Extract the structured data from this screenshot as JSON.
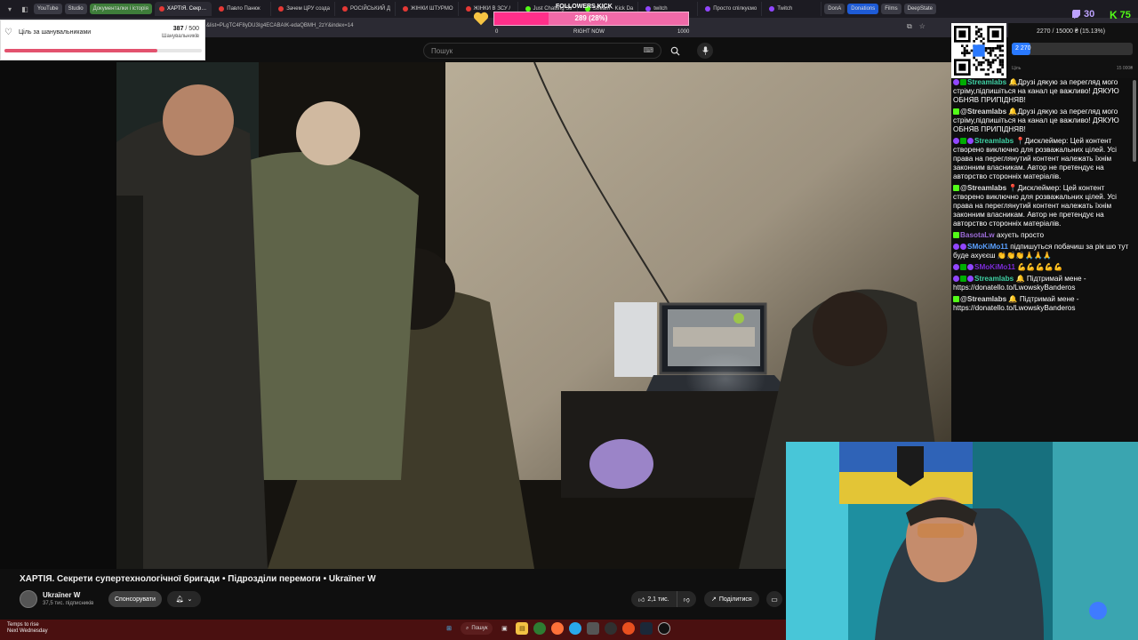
{
  "browser": {
    "bookmarks": [
      {
        "label": "YouTube",
        "green": false
      },
      {
        "label": "Studio",
        "green": false
      },
      {
        "label": "Документалки і історія",
        "green": true
      }
    ],
    "tabs": [
      {
        "label": "ХАРТІЯ. Секр…",
        "active": true,
        "color": "red"
      },
      {
        "label": "Павло Панюк ",
        "active": false,
        "color": "red"
      },
      {
        "label": "Зачем ЦРУ созда",
        "active": false,
        "color": "red"
      },
      {
        "label": "РОСІЙСЬКИЙ Д",
        "active": false,
        "color": "red"
      },
      {
        "label": "ЖІНКИ ШТУРМО",
        "active": false,
        "color": "red"
      },
      {
        "label": "ЖІНКИ В ЗСУ /",
        "active": false,
        "color": "red"
      },
      {
        "label": "Just Chatting Str",
        "active": false,
        "color": "green"
      },
      {
        "label": "Stream - Kick Da",
        "active": false,
        "color": "green"
      },
      {
        "label": "twitch",
        "active": false,
        "color": "purple"
      },
      {
        "label": "Просто спілкуємо",
        "active": false,
        "color": "purple"
      },
      {
        "label": "Twitch",
        "active": false,
        "color": "purple"
      }
    ],
    "extra_bookmarks": [
      "DonA",
      "Donations",
      "Films",
      "DeepState"
    ],
    "url": "&list=PLgTC4F8yDU3Ig4ECABAIK-edaQBMH_2zY&index=14"
  },
  "youtube": {
    "search_placeholder": "Пошук",
    "video_title": "ХАРТІЯ. Секрети супертехнологічної бригади • Підрозділи перемоги • Ukraїner W",
    "channel_name": "Ukraїner W",
    "channel_subs": "37,5 тис. підписників",
    "sponsor_label": "Спонсорувати",
    "like_count": "2,1 тис.",
    "share_label": "Поділитися"
  },
  "goal_widget": {
    "title": "Ціль за шанувальниками",
    "current": "387",
    "target": "/ 500",
    "subtitle": "Шанувальників",
    "progress": 0.774
  },
  "donation_bar": {
    "header": "FOLLOWERS KICK",
    "label": "289 (28%)",
    "progress": 0.28,
    "min": "0",
    "mid": "RIGHT NOW",
    "max": "1000"
  },
  "counters": {
    "twitch_viewers": "30",
    "kick_viewers": "75"
  },
  "donate_goal": {
    "text": "2270 / 15000 ₴ (15.13%)",
    "fill_label": "2 270",
    "progress": 0.1513,
    "min_label": "Ціль",
    "max_label": "15 000₴"
  },
  "chat": [
    {
      "badges": [
        "tw",
        "mod"
      ],
      "nick": "Streamlabs",
      "nick_color": "#3fd0a4",
      "text": "🔔Друзі дякую за перегляд мого стріму,підпишіться на канал це важливо! ДЯКУЮ ОБНЯВ ПРИПІДНЯВ!"
    },
    {
      "badges": [
        "kick"
      ],
      "nick": "@Streamlabs",
      "nick_color": "#dddddd",
      "text": "🔔Друзі дякую за перегляд мого стріму,підпишіться на канал це важливо! ДЯКУЮ ОБНЯВ ПРИПІДНЯВ!"
    },
    {
      "badges": [
        "tw",
        "mod",
        "tw"
      ],
      "nick": "Streamlabs",
      "nick_color": "#3fd0a4",
      "text": "📍Дисклеймер: Цей контент створено виключно для розважальних цілей. Усі права на переглянутий контент належать їхнім законним власникам. Автор не претендує на авторство сторонніх матеріалів."
    },
    {
      "badges": [
        "kick"
      ],
      "nick": "@Streamlabs",
      "nick_color": "#dddddd",
      "text": "📍Дисклеймер: Цей контент створено виключно для розважальних цілей. Усі права на переглянутий контент належать їхнім законним власникам. Автор не претендує на авторство сторонніх матеріалів."
    },
    {
      "badges": [
        "kick"
      ],
      "nick": "BasotaLw",
      "nick_color": "#9b6bd6",
      "text": "ахуєть просто"
    },
    {
      "badges": [
        "tw",
        "heart",
        "tw"
      ],
      "nick": "SMoKiMo11",
      "nick_color": "#5aa0ff",
      "text": "підпишуться побачиш за рік шо тут буде ахуєєш 👏👏👏🙏🙏🙏"
    },
    {
      "badges": [
        "tw",
        "mod",
        "tw"
      ],
      "nick": "SMoKiMo11",
      "nick_color": "#7b2bd6",
      "text": "💪💪💪💪💪"
    },
    {
      "badges": [
        "tw",
        "mod",
        "tw"
      ],
      "nick": "Streamlabs",
      "nick_color": "#3fd0a4",
      "text": "🔔 Підтримай мене - https://donatello.to/LwowskyBanderos"
    },
    {
      "badges": [
        "kick"
      ],
      "nick": "@Streamlabs",
      "nick_color": "#dddddd",
      "text": "🔔 Підтримай мене - https://donatello.to/LwowskyBanderos"
    }
  ],
  "taskbar": {
    "weather_line1": "Temps to rise",
    "weather_line2": "Next Wednesday",
    "search_label": "Пошук"
  },
  "colors": {
    "yt_bg": "#0f0f0f",
    "taskbar": "#4a1010",
    "goal_fill": "#e3526e",
    "donbar": "#ff2f8a",
    "kick_green": "#53fc18",
    "twitch_purple": "#9146ff"
  }
}
